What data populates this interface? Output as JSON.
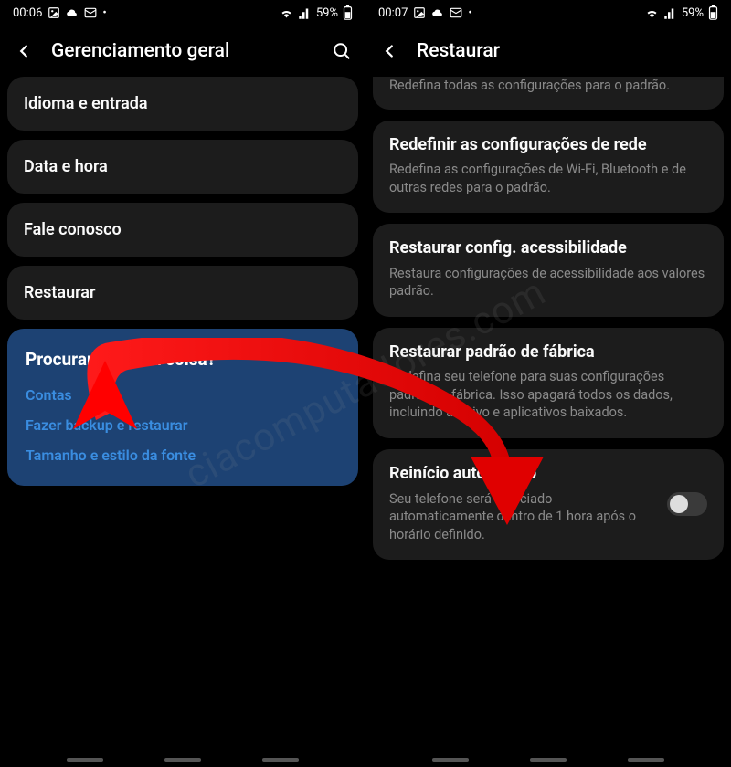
{
  "left": {
    "status": {
      "time": "00:06",
      "battery": "59%"
    },
    "appbar": {
      "title": "Gerenciamento geral"
    },
    "items": [
      {
        "label": "Idioma e entrada"
      },
      {
        "label": "Data e hora"
      },
      {
        "label": "Fale conosco"
      },
      {
        "label": "Restaurar"
      }
    ],
    "suggest": {
      "title": "Procurando outra coisa?",
      "links": [
        "Contas",
        "Fazer backup e restaurar",
        "Tamanho e estilo da fonte"
      ]
    }
  },
  "right": {
    "status": {
      "time": "00:07",
      "battery": "59%"
    },
    "appbar": {
      "title": "Restaurar"
    },
    "cut_desc": "Redefina todas as configurações para o padrão.",
    "cards": [
      {
        "title": "Redefinir as configurações de rede",
        "desc": "Redefina as configurações de Wi-Fi, Bluetooth e de outras redes para o padrão."
      },
      {
        "title": "Restaurar config. acessibilidade",
        "desc": "Restaura configurações de acessibilidade aos valores padrão."
      },
      {
        "title": "Restaurar padrão de fábrica",
        "desc": "Redefina seu telefone para suas configurações padrão de fábrica. Isso apagará todos os dados, incluindo arquivo e aplicativos baixados."
      }
    ],
    "toggle": {
      "title": "Reinício automático",
      "desc": "Seu telefone será reiniciado automaticamente dentro de 1 hora após o horário definido."
    }
  },
  "watermark": "ciacomputadores.com"
}
